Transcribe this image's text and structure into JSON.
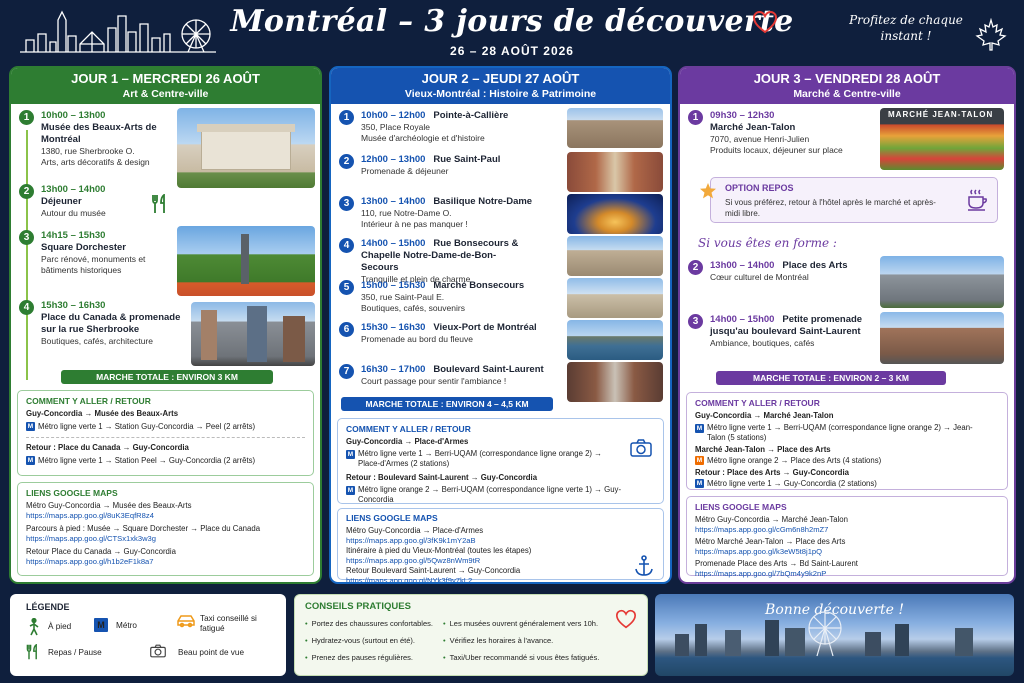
{
  "header": {
    "title": "Montréal – 3 jours de découverte",
    "dates": "26 – 28 AOÛT 2026",
    "tagline": "Profitez de chaque instant !"
  },
  "day1": {
    "title": "JOUR 1 – MERCREDI 26 AOÛT",
    "subtitle": "Art & Centre-ville",
    "stops": [
      {
        "n": "1",
        "time": "10h00 – 13h00",
        "place": "Musée des Beaux-Arts de Montréal",
        "addr": "1380, rue Sherbrooke O.",
        "desc": "Arts, arts décoratifs & design"
      },
      {
        "n": "2",
        "time": "13h00 – 14h00",
        "place": "Déjeuner",
        "desc": "Autour du musée"
      },
      {
        "n": "3",
        "time": "14h15 – 15h30",
        "place": "Square Dorchester",
        "desc": "Parc rénové, monuments et bâtiments historiques"
      },
      {
        "n": "4",
        "time": "15h30 – 16h30",
        "place": "Place du Canada & promenade sur la rue Sherbrooke",
        "desc": "Boutiques, cafés, architecture"
      }
    ],
    "total": "MARCHE TOTALE : ENVIRON 3 KM",
    "route_title": "COMMENT Y ALLER / RETOUR",
    "route": [
      "Guy-Concordia → Musée des Beaux-Arts",
      "Métro ligne verte 1 → Station Guy-Concordia → Peel (2 arrêts)",
      "Retour : Place du Canada → Guy-Concordia",
      "Métro ligne verte 1 → Station Peel → Guy-Concordia (2 arrêts)"
    ],
    "links_title": "LIENS GOOGLE MAPS",
    "links": [
      {
        "label": "Métro Guy-Concordia → Musée des Beaux-Arts",
        "url": "https://maps.app.goo.gl/8uK3EqfR8z4"
      },
      {
        "label": "Parcours à pied : Musée → Square Dorchester → Place du Canada",
        "url": "https://maps.app.goo.gl/CTSx1xk3w3g"
      },
      {
        "label": "Retour Place du Canada → Guy-Concordia",
        "url": "https://maps.app.goo.gl/h1b2eF1k8a7"
      }
    ]
  },
  "day2": {
    "title": "JOUR 2 – JEUDI 27 AOÛT",
    "subtitle": "Vieux-Montréal : Histoire & Patrimoine",
    "stops": [
      {
        "n": "1",
        "time": "10h00 – 12h00",
        "place": "Pointe-à-Callière",
        "addr": "350, Place Royale",
        "desc": "Musée d'archéologie et d'histoire"
      },
      {
        "n": "2",
        "time": "12h00 – 13h00",
        "place": "Rue Saint-Paul",
        "desc": "Promenade & déjeuner"
      },
      {
        "n": "3",
        "time": "13h00 – 14h00",
        "place": "Basilique Notre-Dame",
        "addr": "110, rue Notre-Dame O.",
        "desc": "Intérieur à ne pas manquer !"
      },
      {
        "n": "4",
        "time": "14h00 – 15h00",
        "place": "Rue Bonsecours & Chapelle Notre-Dame-de-Bon-Secours",
        "desc": "Tranquille et plein de charme"
      },
      {
        "n": "5",
        "time": "15h00 – 15h30",
        "place": "Marché Bonsecours",
        "addr": "350, rue Saint-Paul E.",
        "desc": "Boutiques, cafés, souvenirs"
      },
      {
        "n": "6",
        "time": "15h30 – 16h30",
        "place": "Vieux-Port de Montréal",
        "desc": "Promenade au bord du fleuve"
      },
      {
        "n": "7",
        "time": "16h30 – 17h00",
        "place": "Boulevard Saint-Laurent",
        "desc": "Court passage pour sentir l'ambiance !"
      }
    ],
    "total": "MARCHE TOTALE : ENVIRON 4 – 4,5 KM",
    "route_title": "COMMENT Y ALLER / RETOUR",
    "route": [
      "Guy-Concordia → Place-d'Armes",
      "Métro ligne verte 1 → Berri-UQAM (correspondance ligne orange 2) → Place-d'Armes (2 stations)",
      "Retour : Boulevard Saint-Laurent → Guy-Concordia",
      "Métro ligne orange 2 → Berri-UQAM (correspondance ligne verte 1) → Guy-Concordia"
    ],
    "links_title": "LIENS GOOGLE MAPS",
    "links": [
      {
        "label": "Métro Guy-Concordia → Place-d'Armes",
        "url": "https://maps.app.goo.gl/3fK9k1mY2aB"
      },
      {
        "label": "Itinéraire à pied du Vieux-Montréal (toutes les étapes)",
        "url": "https://maps.app.goo.gl/5Qwz8nWm9tR"
      },
      {
        "label": "Retour Boulevard Saint-Laurent → Guy-Concordia",
        "url": "https://maps.app.goo.gl/NYk3f9y7kL2"
      }
    ]
  },
  "day3": {
    "title": "JOUR 3 – VENDREDI 28 AOÛT",
    "subtitle": "Marché & Centre-ville",
    "stops": [
      {
        "n": "1",
        "time": "09h30 – 12h30",
        "place": "Marché Jean-Talon",
        "addr": "7070, avenue Henri-Julien",
        "desc": "Produits locaux, déjeuner sur place"
      },
      {
        "n": "2",
        "time": "13h00 – 14h00",
        "place": "Place des Arts",
        "desc": "Cœur culturel de Montréal"
      },
      {
        "n": "3",
        "time": "14h00 – 15h00",
        "place": "Petite promenade jusqu'au boulevard Saint-Laurent",
        "desc": "Ambiance, boutiques, cafés"
      }
    ],
    "repos_title": "OPTION REPOS",
    "repos_text": "Si vous préférez, retour à l'hôtel après le marché et après-midi libre.",
    "forme": "Si vous êtes en forme :",
    "market_sign": "MARCHÉ JEAN-TALON",
    "total": "MARCHE TOTALE : ENVIRON 2 – 3 KM",
    "route_title": "COMMENT Y ALLER / RETOUR",
    "route": [
      "Guy-Concordia → Marché Jean-Talon",
      "Métro ligne verte 1 → Berri-UQAM (correspondance ligne orange 2) → Jean-Talon (5 stations)",
      "Marché Jean-Talon → Place des Arts",
      "Métro ligne orange 2 → Place des Arts (4 stations)",
      "Retour : Place des Arts → Guy-Concordia",
      "Métro ligne verte 1 → Guy-Concordia (2 stations)"
    ],
    "links_title": "LIENS GOOGLE MAPS",
    "links": [
      {
        "label": "Métro Guy-Concordia → Marché Jean-Talon",
        "url": "https://maps.app.goo.gl/cGm6n8h2mZ7"
      },
      {
        "label": "Métro Marché Jean-Talon → Place des Arts",
        "url": "https://maps.app.goo.gl/k3eW5t8j1pQ"
      },
      {
        "label": "Promenade Place des Arts → Bd Saint-Laurent",
        "url": "https://maps.app.goo.gl/7bQm4y9k2nP"
      }
    ]
  },
  "legend": {
    "title": "LÉGENDE",
    "walk": "À pied",
    "metro": "Métro",
    "taxi": "Taxi conseillé si fatigué",
    "meal": "Repas / Pause",
    "photo": "Beau point de vue",
    "metro_symbol": "M"
  },
  "tips": {
    "title": "CONSEILS PRATIQUES",
    "items": [
      "Portez des chaussures confortables.",
      "Hydratez-vous (surtout en été).",
      "Prenez des pauses régulières.",
      "Les musées ouvrent généralement vers 10h.",
      "Vérifiez les horaires à l'avance.",
      "Taxi/Uber recommandé si vous êtes fatigués."
    ]
  },
  "bonne": "Bonne découverte !",
  "colors": {
    "day1": "#2e7d32",
    "day2": "#1553b0",
    "day3": "#6b3aa0",
    "navy": "#0f1f3d",
    "orange": "#ef6c00"
  }
}
